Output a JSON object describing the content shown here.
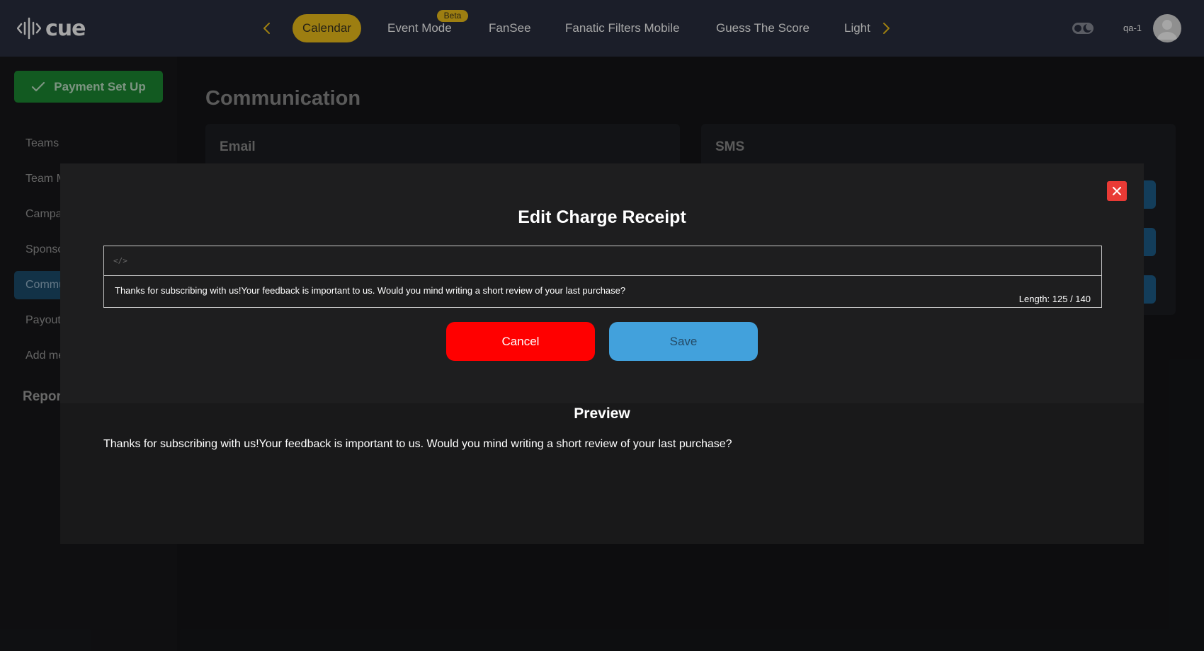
{
  "app": {
    "logo_text": "cue"
  },
  "topnav": {
    "tabs": [
      {
        "label": "Calendar",
        "active": true
      },
      {
        "label": "Event Mode",
        "badge": "Beta"
      },
      {
        "label": "FanSee"
      },
      {
        "label": "Fanatic Filters Mobile"
      },
      {
        "label": "Guess The Score"
      },
      {
        "label": "Light"
      }
    ],
    "username": "qa-1"
  },
  "sidebar": {
    "payment_button": "Payment Set Up",
    "items": [
      {
        "label": "Teams"
      },
      {
        "label": "Team Members"
      },
      {
        "label": "Campaigns"
      },
      {
        "label": "Sponsors"
      },
      {
        "label": "Communication",
        "active": true
      },
      {
        "label": "Payouts"
      },
      {
        "label": "Add members"
      }
    ],
    "section_reports": "Reports"
  },
  "main": {
    "title": "Communication",
    "panels": [
      {
        "title": "Email"
      },
      {
        "title": "SMS"
      }
    ]
  },
  "modal": {
    "title": "Edit Charge Receipt",
    "editor": {
      "text": "Thanks for subscribing with us!Your feedback is important to us. Would you mind writing a short review of your last purchase?",
      "length_label": "Length: 125 / 140"
    },
    "cancel_label": "Cancel",
    "save_label": "Save",
    "preview_title": "Preview",
    "preview_text": "Thanks for subscribing with us!Your feedback is important to us. Would you mind writing a short review of your last purchase?"
  },
  "colors": {
    "topbar": "#2a2f3f",
    "accent_yellow": "#f2c21b",
    "cancel_red": "#ff0000",
    "save_blue": "#42a1dc",
    "close_red": "#e93a35",
    "payment_green": "#1d8a33"
  }
}
